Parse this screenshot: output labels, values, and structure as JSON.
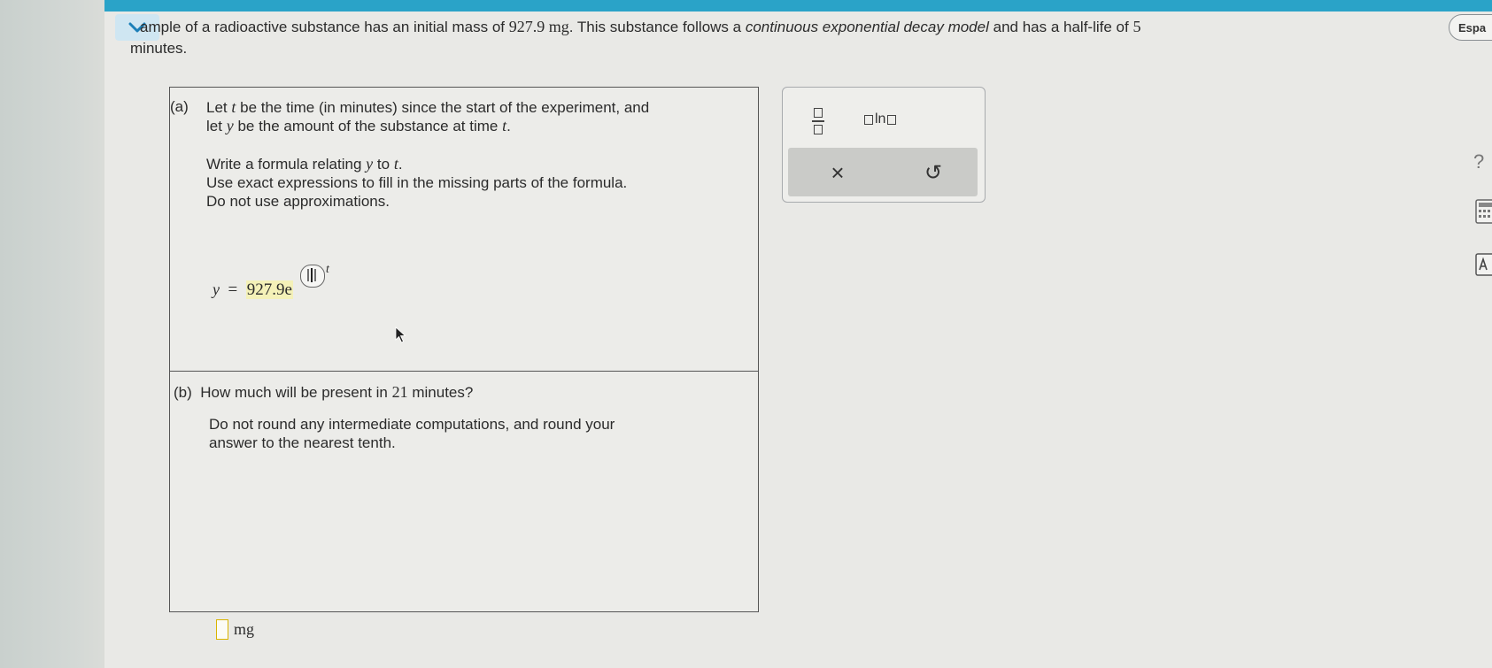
{
  "header": {
    "prompt_pre": "ample of a radioactive substance has an initial mass of",
    "initial_mass": "927.9 mg",
    "prompt_mid": ". This substance follows a",
    "model_phrase": "continuous exponential decay model",
    "prompt_post": "and has a half-life of",
    "half_life": "5",
    "prompt_end": "minutes.",
    "language_button": "Espa"
  },
  "part_a": {
    "label": "(a)",
    "line1_pre": "Let",
    "var_t": "t",
    "line1_post": "be the time (in minutes) since the start of the experiment, and",
    "line2_pre": "let",
    "var_y": "y",
    "line2_post": "be the amount of the substance at time",
    "line2_end": ".",
    "instr1_pre": "Write a formula relating",
    "instr1_mid": "to",
    "instr1_end": ".",
    "instr2": "Use exact expressions to fill in the missing parts of the formula.",
    "instr3": "Do not use approximations.",
    "formula_lhs": "y",
    "formula_eq": "=",
    "formula_coef": "927.9e",
    "exponent_var": "t"
  },
  "part_b": {
    "label": "(b)",
    "question_pre": "How much will be present in",
    "minutes_value": "21",
    "question_post": "minutes?",
    "instr1": "Do not round any intermediate computations, and round your",
    "instr2": "answer to the nearest tenth.",
    "unit": "mg"
  },
  "toolbox": {
    "ln_text": "ln",
    "clear_symbol": "×",
    "undo_symbol": "↺"
  },
  "sidebar": {
    "help_symbol": "?"
  },
  "colors": {
    "top_bar": "#2aa3c8",
    "collapse_bg": "#cfe6f2",
    "highlight": "#f4f1b8",
    "answer_border": "#d9b400"
  }
}
